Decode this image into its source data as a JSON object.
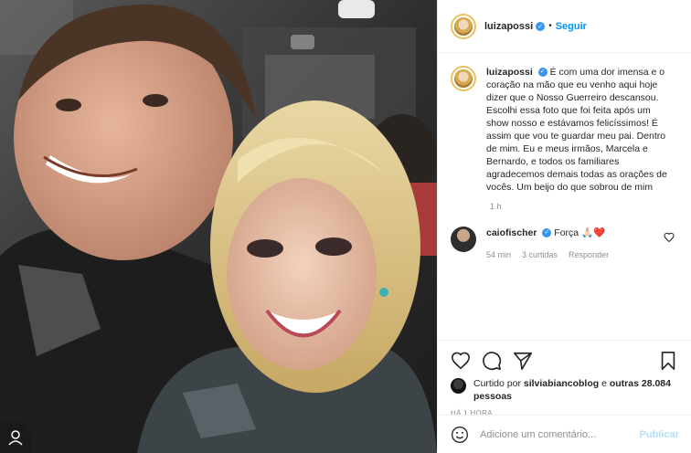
{
  "header": {
    "username": "luizapossi",
    "separator": "•",
    "follow_label": "Seguir"
  },
  "caption": {
    "username": "luizapossi",
    "text": "É com uma dor imensa e o coração na mão que eu venho aqui hoje dizer que o Nosso Guerreiro descansou. Escolhi essa foto que foi feita após um show nosso e estávamos felicíssimos! É assim que vou te guardar meu pai. Dentro de mim. Eu e meus irmãos, Marcela e Bernardo, e todos os familiares agradecemos demais todas as orações de vocês. Um beijo do que sobrou de mim",
    "time": "1 h"
  },
  "comments": [
    {
      "username": "caiofischer",
      "text": "Força 🙏🏻❤️",
      "time": "54 min",
      "likes": "3 curtidas",
      "reply_label": "Responder"
    }
  ],
  "likes": {
    "prefix": "Curtido por",
    "user": "silviabiancoblog",
    "conj": "e",
    "others": "outras 28.084 pessoas"
  },
  "post_time": "HÁ 1 HORA",
  "add_comment": {
    "placeholder": "Adicione um comentário...",
    "publish_label": "Publicar"
  },
  "icons": {
    "like": "heart-icon",
    "comment": "comment-icon",
    "share": "share-icon",
    "save": "bookmark-icon",
    "emoji": "emoji-icon"
  }
}
